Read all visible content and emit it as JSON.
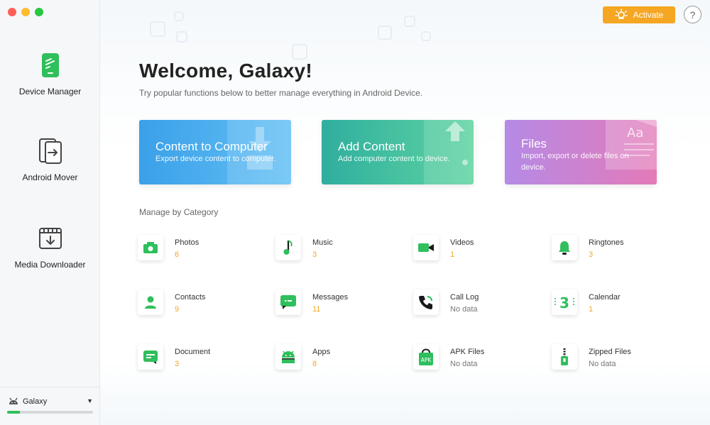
{
  "sidebar": {
    "items": [
      {
        "label": "Device Manager",
        "icon": "phone-icon"
      },
      {
        "label": "Android Mover",
        "icon": "transfer-icon"
      },
      {
        "label": "Media Downloader",
        "icon": "download-icon"
      }
    ],
    "device": {
      "name": "Galaxy",
      "storage_used_fraction": 0.15
    }
  },
  "header": {
    "activate_label": "Activate",
    "help_label": "?"
  },
  "main": {
    "title": "Welcome, Galaxy!",
    "subtitle": "Try popular functions below to better manage everything in Android Device.",
    "cards": [
      {
        "title": "Content to Computer",
        "desc": "Export device content to computer."
      },
      {
        "title": "Add Content",
        "desc": "Add computer content to device."
      },
      {
        "title": "Files",
        "desc": "Import, export or delete files on device."
      }
    ],
    "section_label": "Manage by Category",
    "categories": [
      {
        "name": "Photos",
        "count": "6"
      },
      {
        "name": "Music",
        "count": "3"
      },
      {
        "name": "Videos",
        "count": "1"
      },
      {
        "name": "Ringtones",
        "count": "3"
      },
      {
        "name": "Contacts",
        "count": "9"
      },
      {
        "name": "Messages",
        "count": "11"
      },
      {
        "name": "Call Log",
        "count": "No data"
      },
      {
        "name": "Calendar",
        "count": "1"
      },
      {
        "name": "Document",
        "count": "3"
      },
      {
        "name": "Apps",
        "count": "8"
      },
      {
        "name": "APK Files",
        "count": "No data"
      },
      {
        "name": "Zipped Files",
        "count": "No data"
      }
    ],
    "icon_labels": {
      "apk": "APK",
      "calendar": "3",
      "files_art": "Aa"
    }
  },
  "colors": {
    "accent_green": "#2fbf5c",
    "activate_orange": "#f5a623",
    "count_orange": "#f5a623"
  }
}
